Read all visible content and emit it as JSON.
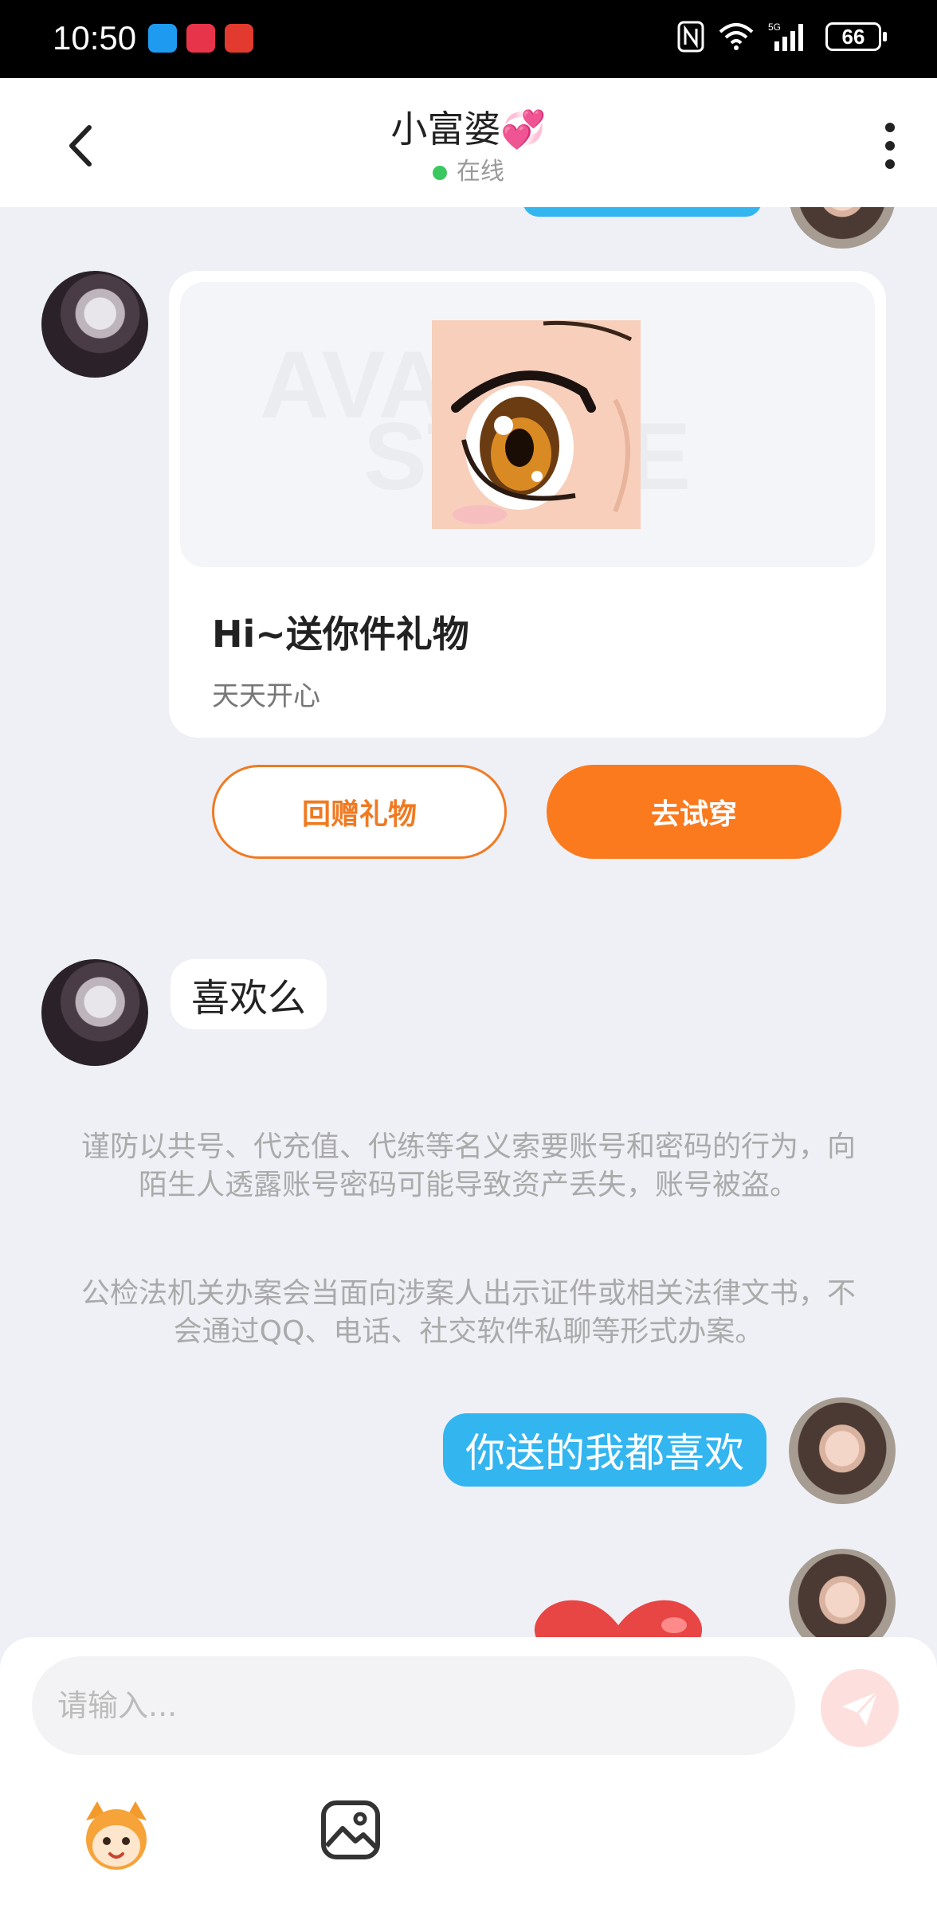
{
  "status_bar": {
    "time": "10:50",
    "battery": "66"
  },
  "header": {
    "title": "小富婆💞",
    "status": "在线"
  },
  "gift_card": {
    "title": "Hi~送你件礼物",
    "subtitle": "天天开心",
    "return_gift_label": "回赠礼物",
    "try_on_label": "去试穿",
    "watermark_line1": "AVATAR",
    "watermark_line2": "STORE"
  },
  "messages": {
    "left_text": "喜欢么",
    "right_text": "你送的我都喜欢"
  },
  "notices": {
    "fraud_warning": "谨防以共号、代充值、代练等名义索要账号和密码的行为，向陌生人透露账号密码可能导致资产丢失，账号被盗。",
    "police_notice": "公检法机关办案会当面向涉案人出示证件或相关法律文书，不会通过QQ、电话、社交软件私聊等形式办案。"
  },
  "input": {
    "placeholder": "请输入..."
  },
  "colors": {
    "accent_orange": "#fb7a1e",
    "bubble_blue": "#33b5f0",
    "online_green": "#3bc861"
  }
}
